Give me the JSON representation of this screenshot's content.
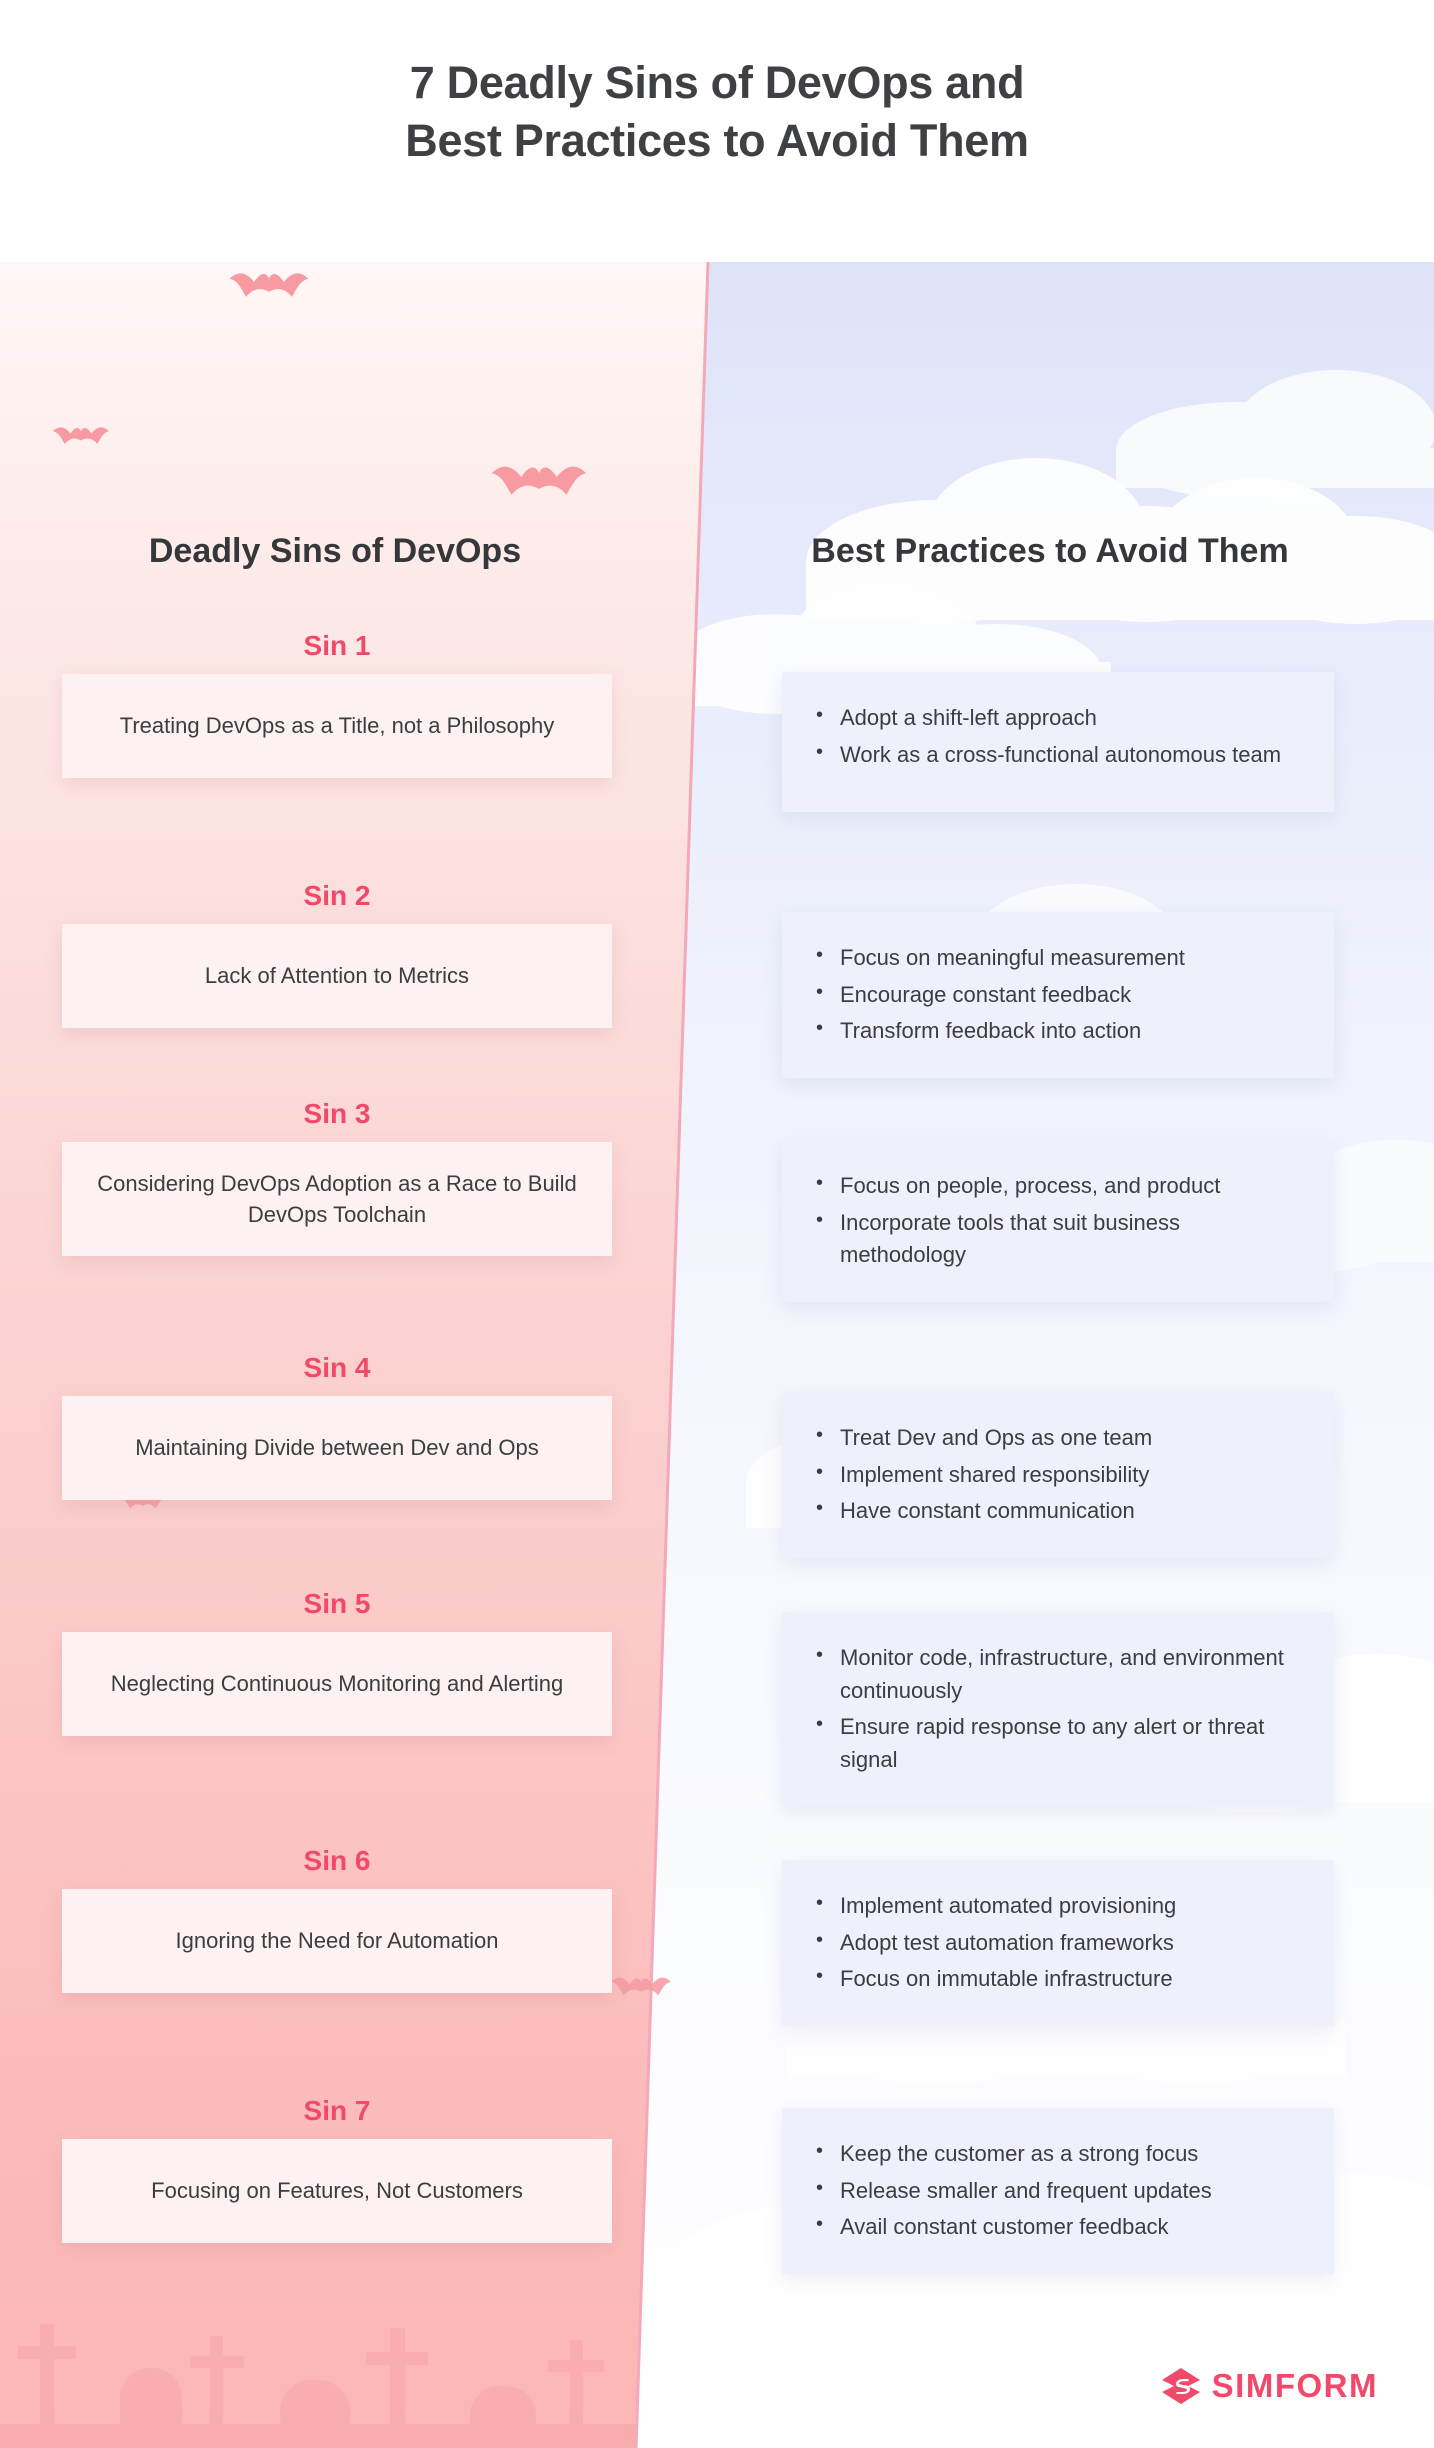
{
  "title": {
    "line1": "7 Deadly Sins of DevOps and",
    "line2": "Best Practices to Avoid Them"
  },
  "columns": {
    "left_header": "Deadly Sins of DevOps",
    "right_header": "Best Practices to Avoid Them"
  },
  "colors": {
    "accent_pink": "#f2496a",
    "heading_dark": "#3e4043",
    "left_panel_top": "#fff7f6",
    "left_panel_bottom": "#fbb6b5",
    "right_panel_top": "#dfe3f8",
    "right_panel_bottom": "#ffffff",
    "sin_card_bg": "#fdf2f1",
    "practice_card_bg": "#eef0fb",
    "bat_color": "#f7a6ab"
  },
  "rows": [
    {
      "sin_label": "Sin 1",
      "sin_text": "Treating DevOps as a Title, not a Philosophy",
      "practices": [
        "Adopt a shift-left approach",
        "Work as a cross-functional autonomous team"
      ]
    },
    {
      "sin_label": "Sin 2",
      "sin_text": "Lack of Attention to Metrics",
      "practices": [
        "Focus on meaningful measurement",
        "Encourage constant feedback",
        "Transform feedback into action"
      ]
    },
    {
      "sin_label": "Sin 3",
      "sin_text": "Considering DevOps Adoption as a Race to Build DevOps Toolchain",
      "practices": [
        "Focus on people, process, and product",
        "Incorporate tools that suit business methodology"
      ]
    },
    {
      "sin_label": "Sin 4",
      "sin_text": "Maintaining Divide between Dev and Ops",
      "practices": [
        "Treat Dev and Ops as one team",
        "Implement shared responsibility",
        "Have constant communication"
      ]
    },
    {
      "sin_label": "Sin 5",
      "sin_text": "Neglecting Continuous Monitoring and Alerting",
      "practices": [
        "Monitor code, infrastructure, and environment continuously",
        "Ensure rapid response to any alert or threat signal"
      ]
    },
    {
      "sin_label": "Sin 6",
      "sin_text": "Ignoring the Need for Automation",
      "practices": [
        "Implement automated provisioning",
        "Adopt test automation frameworks",
        "Focus on immutable infrastructure"
      ]
    },
    {
      "sin_label": "Sin 7",
      "sin_text": "Focusing on Features, Not Customers",
      "practices": [
        "Keep the customer as a strong focus",
        "Release smaller and frequent updates",
        "Avail constant customer feedback"
      ]
    }
  ],
  "logo": {
    "text": "SIMFORM",
    "icon": "simform-diamond-icon"
  },
  "layout": {
    "row_tops": [
      630,
      880,
      1098,
      1352,
      1588,
      1845,
      2095
    ],
    "sin_card_tops": [
      682,
      932,
      1150,
      1404,
      1640,
      1897,
      2147
    ],
    "bp_card_tops": [
      672,
      912,
      1140,
      1392,
      1612,
      1860,
      2108
    ],
    "bp_card_heights": [
      140,
      125,
      148,
      130,
      150,
      133,
      143
    ]
  }
}
